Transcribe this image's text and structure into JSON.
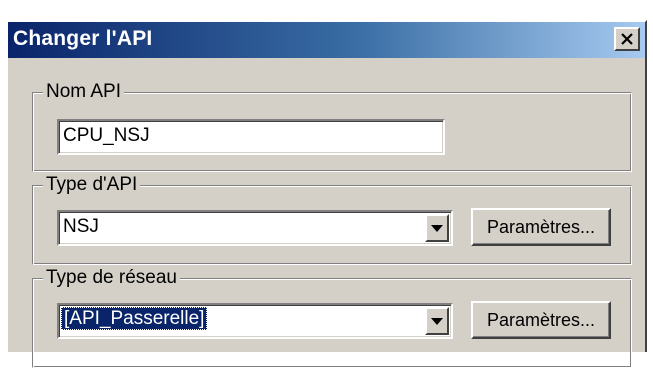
{
  "window": {
    "title": "Changer l'API"
  },
  "groups": {
    "nom_api": {
      "legend": "Nom API",
      "value": "CPU_NSJ"
    },
    "type_api": {
      "legend": "Type d'API",
      "selected": "NSJ",
      "button_label": "Paramètres..."
    },
    "type_reseau": {
      "legend": "Type de réseau",
      "selected": "[API_Passerelle]",
      "button_label": "Paramètres..."
    }
  }
}
